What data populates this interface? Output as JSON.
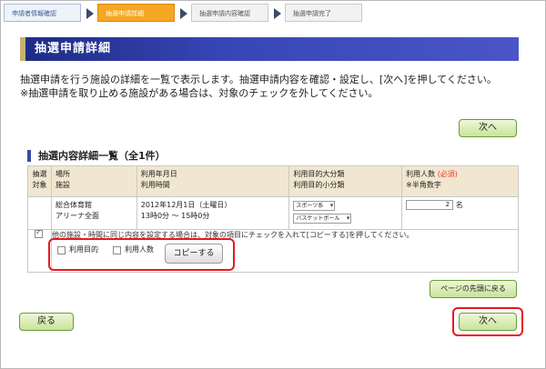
{
  "steps": [
    {
      "label": "申請者情報確認",
      "state": "done"
    },
    {
      "label": "抽選申請詳細",
      "state": "active"
    },
    {
      "label": "抽選申請内容確認",
      "state": "pending"
    },
    {
      "label": "抽選申請完了",
      "state": "pending"
    }
  ],
  "page_title": "抽選申請詳細",
  "intro": {
    "line1": "抽選申請を行う施設の詳細を一覧で表示します。抽選申請内容を確認・設定し、[次へ]を押してください。",
    "line2": "※抽選申請を取り止める施設がある場合は、対象のチェックを外してください。"
  },
  "buttons": {
    "next": "次へ",
    "back": "戻る",
    "page_top": "ページの先頭に戻る",
    "copy": "コピーする"
  },
  "section_title": "抽選内容詳細一覧（全1件）",
  "table": {
    "headers": {
      "target_line1": "抽選",
      "target_line2": "対象",
      "place_line1": "場所",
      "place_line2": "施設",
      "date_line1": "利用年月日",
      "date_line2": "利用時間",
      "purpose_line1": "利用目的大分類",
      "purpose_line2": "利用目的小分類",
      "people_line1": "利用人数",
      "people_required": "(必須)",
      "people_line2": "※半角数字"
    },
    "rows": [
      {
        "checked": true,
        "place": "総合体育館",
        "facility": "アリーナ全面",
        "date": "2012年12月1日（土曜日）",
        "time": "13時0分 〜 15時0分",
        "purpose_major": "スポーツ系",
        "purpose_minor": "バスケットボール",
        "people": "2",
        "people_unit": "名"
      }
    ]
  },
  "copy_section": {
    "instruction": "他の施設・時間に同じ内容を設定する場合は、対象の項目にチェックを入れて[コピーする]を押してください。",
    "option_purpose": "利用目的",
    "option_people": "利用人数"
  },
  "colors": {
    "title_bar": "#2a37a0",
    "active_step": "#f5a623",
    "highlight_box": "#e8171f",
    "table_header": "#f1e7d0",
    "button_green": "#c9e39a"
  }
}
